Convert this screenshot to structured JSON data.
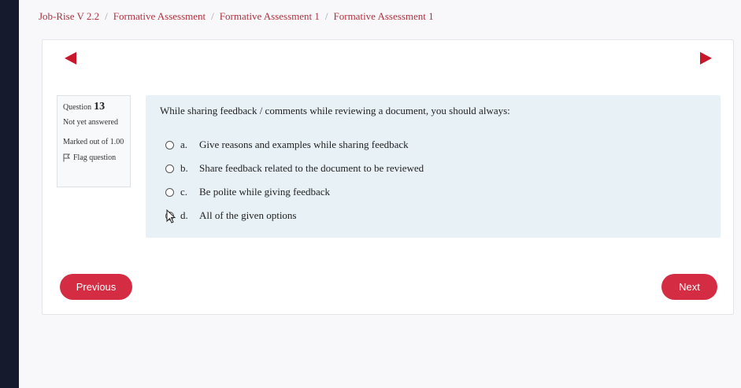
{
  "breadcrumb": {
    "items": [
      "Job-Rise V 2.2",
      "Formative Assessment",
      "Formative Assessment 1",
      "Formative Assessment 1"
    ],
    "separator": "/"
  },
  "question_info": {
    "label": "Question",
    "number": "13",
    "state": "Not yet answered",
    "grade": "Marked out of 1.00",
    "flag_label": "Flag question"
  },
  "question": {
    "text": "While sharing feedback / comments while reviewing a document, you should always:",
    "options": [
      {
        "letter": "a.",
        "text": "Give reasons and examples while sharing feedback"
      },
      {
        "letter": "b.",
        "text": "Share feedback related to the document to be reviewed"
      },
      {
        "letter": "c.",
        "text": "Be polite while giving feedback"
      },
      {
        "letter": "d.",
        "text": "All of the given options"
      }
    ]
  },
  "buttons": {
    "previous": "Previous",
    "next": "Next"
  },
  "colors": {
    "accent": "#d42c43",
    "link": "#b0323f",
    "question_bg": "#e8f1f6"
  },
  "icons": {
    "prev_page": "triangle-left-icon",
    "next_page": "triangle-right-icon",
    "flag": "flag-icon",
    "cursor": "mouse-pointer-icon"
  }
}
